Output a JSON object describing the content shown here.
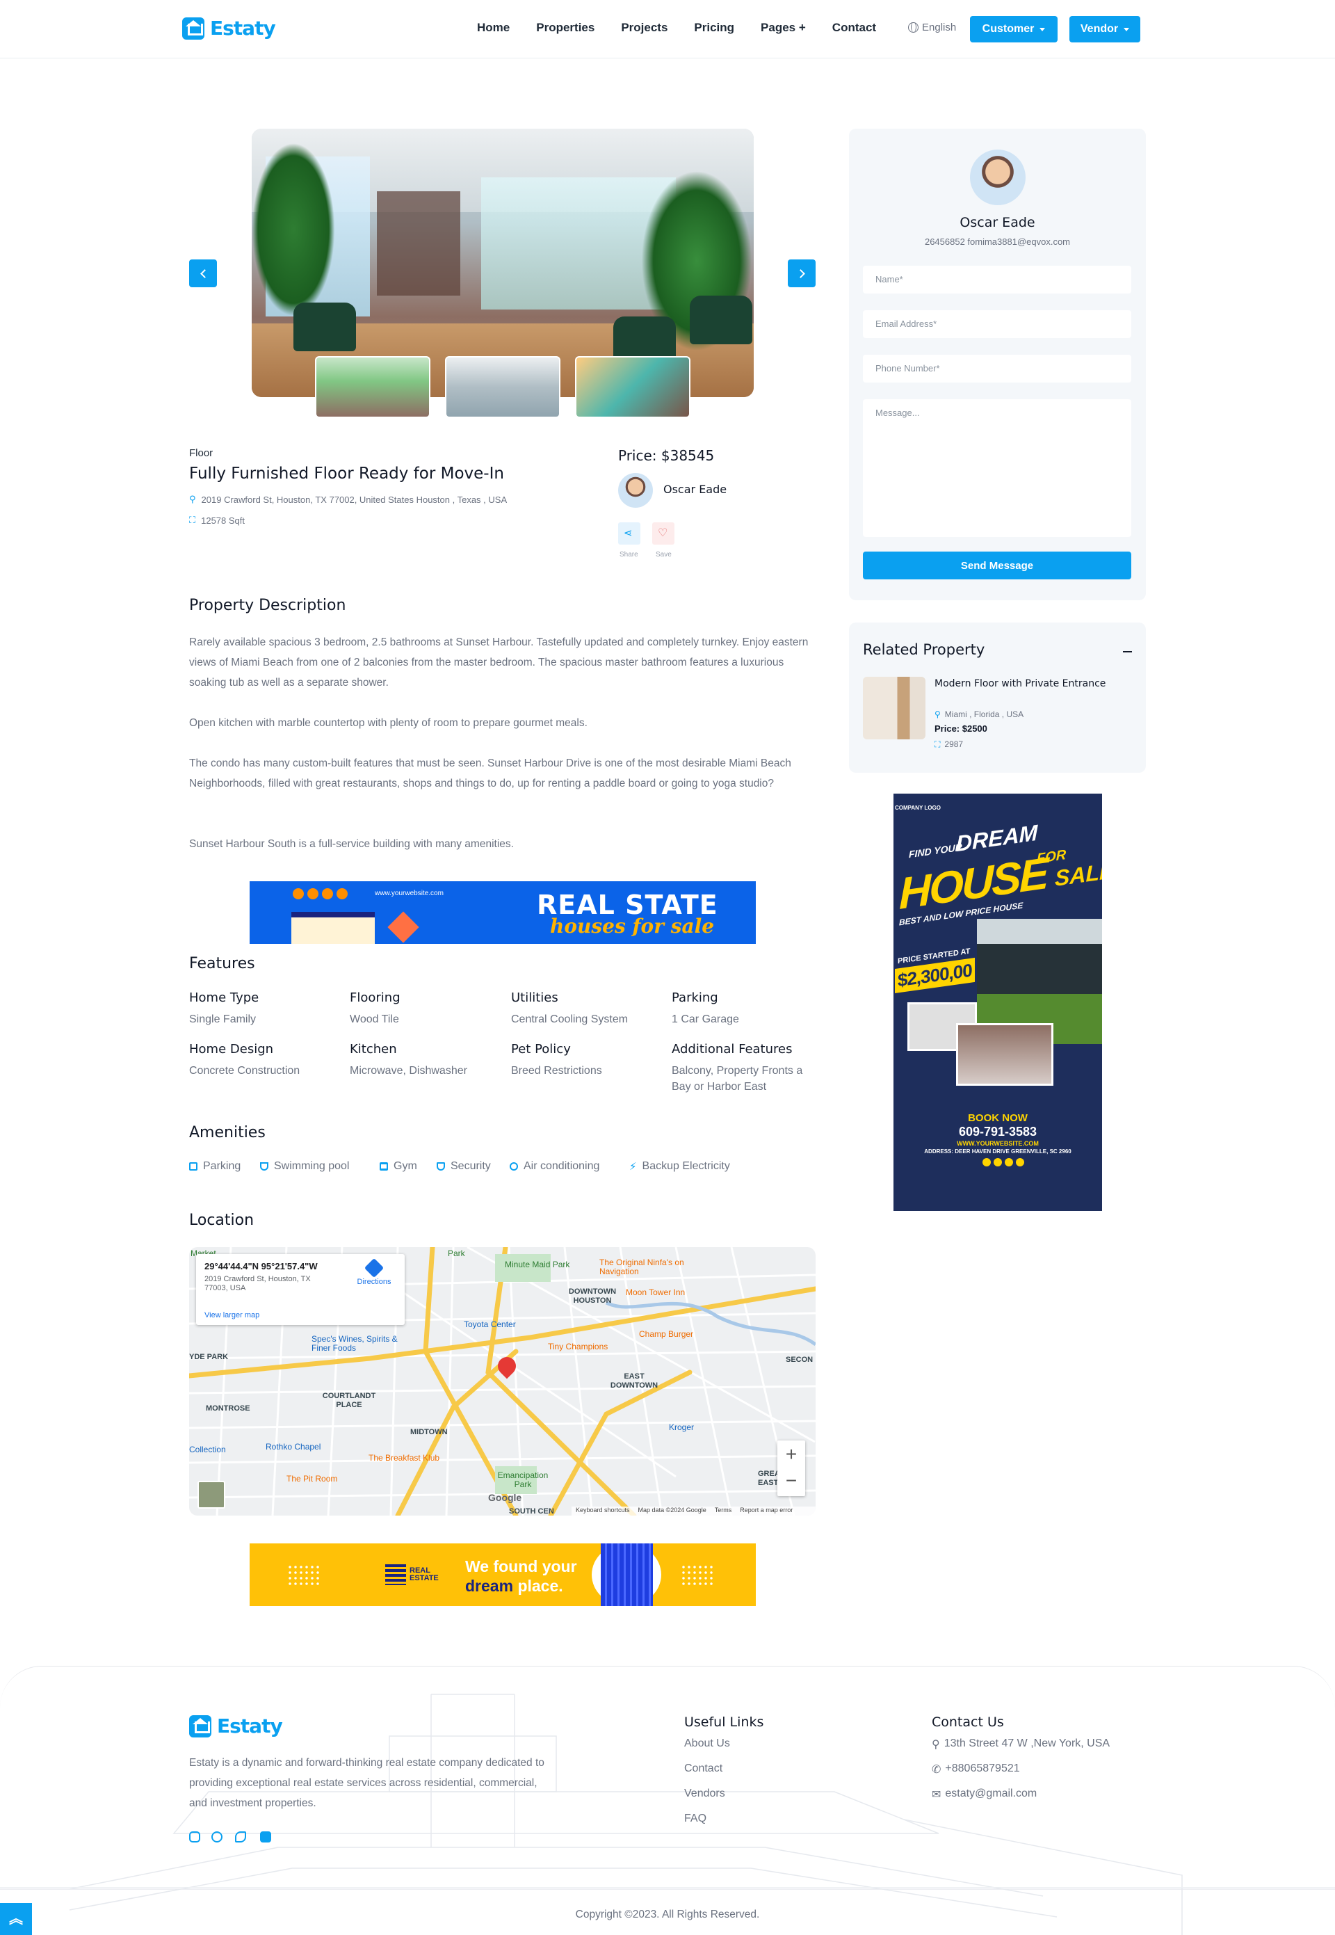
{
  "header": {
    "brand": "Estaty",
    "nav": [
      "Home",
      "Properties",
      "Projects",
      "Pricing",
      "Pages +",
      "Contact"
    ],
    "language": "English",
    "customer_button": "Customer",
    "vendor_button": "Vendor"
  },
  "property": {
    "category": "Floor",
    "title": "Fully Furnished Floor Ready for Move-In",
    "address": "2019 Crawford St, Houston, TX 77002, United States Houston , Texas , USA",
    "area": "12578 Sqft",
    "price": "Price: $38545",
    "agent": "Oscar Eade",
    "share_label": "Share",
    "save_label": "Save"
  },
  "description": {
    "heading": "Property Description",
    "paragraphs": [
      "Rarely available spacious 3 bedroom, 2.5 bathrooms at Sunset Harbour. Tastefully updated and completely turnkey. Enjoy eastern views of Miami Beach from one of 2 balconies from the master bedroom. The spacious master bathroom features a luxurious soaking tub as well as a separate shower.",
      "Open kitchen with marble countertop with plenty of room to prepare gourmet meals.",
      "The condo has many custom-built features that must be seen. Sunset Harbour Drive is one of the most desirable Miami Beach Neighborhoods, filled with great restaurants, shops and things to do, up for renting a paddle board or going to yoga studio?",
      "Sunset Harbour South is a full-service building with many amenities."
    ]
  },
  "banner_top": {
    "website": "www.yourwebsite.com",
    "headline": "REAL STATE",
    "subline": "houses for sale"
  },
  "features": {
    "heading": "Features",
    "items": [
      {
        "label": "Home Type",
        "value": "Single Family"
      },
      {
        "label": "Flooring",
        "value": "Wood Tile"
      },
      {
        "label": "Utilities",
        "value": "Central Cooling System"
      },
      {
        "label": "Parking",
        "value": "1 Car Garage"
      },
      {
        "label": "Home Design",
        "value": "Concrete Construction"
      },
      {
        "label": "Kitchen",
        "value": "Microwave, Dishwasher"
      },
      {
        "label": "Pet Policy",
        "value": "Breed Restrictions"
      },
      {
        "label": "Additional Features",
        "value": "Balcony, Property Fronts a Bay or Harbor East"
      }
    ]
  },
  "amenities": {
    "heading": "Amenities",
    "items": [
      "Parking",
      "Swimming pool",
      "Gym",
      "Security",
      "Air conditioning",
      "Backup Electricity"
    ]
  },
  "location": {
    "heading": "Location",
    "coords": "29°44'44.4\"N 95°21'57.4\"W",
    "address_line1": "2019 Crawford St, Houston, TX",
    "address_line2": "77003, USA",
    "directions": "Directions",
    "larger_map": "View larger map",
    "labels": {
      "minute_maid": "Minute Maid Park",
      "ninfa": "The Original Ninfa's on Navigation",
      "downtown": "DOWNTOWN HOUSTON",
      "moon_tower": "Moon Tower Inn",
      "toyota": "Toyota Center",
      "spec": "Spec's Wines, Spirits & Finer Foods",
      "tiny": "Tiny Champions",
      "champ": "Champ Burger",
      "east_downtown": "EAST DOWNTOWN",
      "second": "SECON",
      "hyde": "YDE PARK",
      "courtlandt": "COURTLANDT PLACE",
      "montrose": "MONTROSE",
      "midtown": "MIDTOWN",
      "kroger": "Kroger",
      "collection": "Collection",
      "rothko": "Rothko Chapel",
      "breakfast": "The Breakfast Klub",
      "pit_room": "The Pit Room",
      "emancipation": "Emancipation Park",
      "south_cen": "SOUTH CEN",
      "greater_east": "GREA EAST",
      "park": "Park",
      "market": "Market"
    },
    "footer_items": [
      "Keyboard shortcuts",
      "Map data ©2024 Google",
      "Terms",
      "Report a map error"
    ],
    "google": "Google"
  },
  "banner_bottom": {
    "brand_line1": "REAL",
    "brand_line2": "ESTATE",
    "line1": "We found your",
    "line2_a": "dream",
    "line2_b": "place."
  },
  "sidebar": {
    "agent_name": "Oscar Eade",
    "agent_contact": "26456852 fomima3881@eqvox.com",
    "fields": {
      "name": "Name*",
      "email": "Email Address*",
      "phone": "Phone Number*",
      "message": "Message..."
    },
    "send_button": "Send Message",
    "related_heading": "Related Property",
    "related": {
      "title": "Modern Floor with Private Entrance",
      "location": "Miami , Florida , USA",
      "price": "Price: $2500",
      "area": "2987"
    }
  },
  "ad": {
    "company": "COMPANY LOGO",
    "find": "FIND YOUR",
    "dream": "DREAM",
    "house": "HOUSE",
    "for_sale_a": "FOR",
    "for_sale_b": "SALE",
    "tagline": "BEST AND LOW PRICE HOUSE",
    "price_label": "PRICE STARTED AT",
    "price": "$2,300,00",
    "book": "BOOK NOW",
    "phone": "609-791-3583",
    "website": "WWW.YOURWEBSITE.COM",
    "address": "ADDRESS: DEER HAVEN DRIVE GREENVILLE, SC 2960"
  },
  "footer": {
    "brand": "Estaty",
    "about": "Estaty is a dynamic and forward-thinking real estate company dedicated to providing exceptional real estate services across residential, commercial, and investment properties.",
    "useful_heading": "Useful Links",
    "useful_links": [
      "About Us",
      "Contact",
      "Vendors",
      "FAQ"
    ],
    "contact_heading": "Contact Us",
    "address": "13th Street 47 W ,New York, USA",
    "phone": "+88065879521",
    "email": "estaty@gmail.com",
    "copyright": "Copyright ©2023. All Rights Reserved."
  },
  "colors": {
    "accent": "#0aa0f0",
    "ad_navy": "#1e2e5c",
    "ad_yellow": "#ffd400",
    "banner_blue": "#0b63e8",
    "banner_yellow": "#ffc107"
  }
}
